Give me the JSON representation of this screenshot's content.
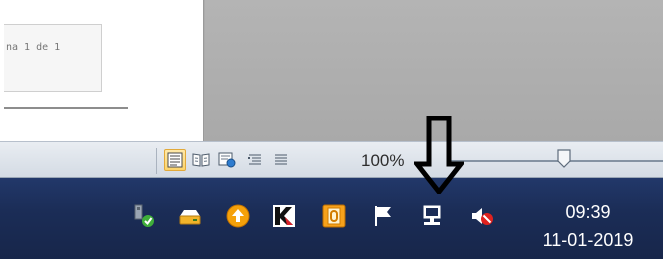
{
  "document": {
    "page_indicator": "na 1 de 1"
  },
  "statusbar": {
    "zoom_label": "100%",
    "zoom_value_percent": 100
  },
  "tray": {
    "icons": [
      "usb-safely-remove-icon",
      "drive-icon",
      "update-arrow-icon",
      "kaspersky-icon",
      "office-icon",
      "action-center-flag-icon",
      "network-icon",
      "volume-muted-icon"
    ]
  },
  "clock": {
    "time": "09:39",
    "date": "11-01-2019"
  },
  "colors": {
    "taskbar": "#1b2d57",
    "status_bar": "#dde3ea",
    "active_view": "#fcd46b"
  }
}
